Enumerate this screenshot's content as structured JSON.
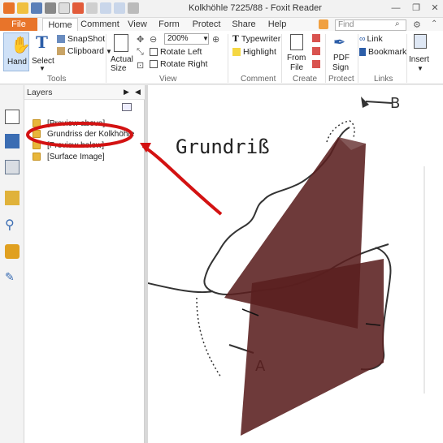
{
  "window": {
    "title": "Kolkhöhle 7225/88 - Foxit Reader",
    "minimize": "—",
    "restore": "❐",
    "close": "✕"
  },
  "tabs": {
    "file": "File",
    "items": [
      "Home",
      "Comment",
      "View",
      "Form",
      "Protect",
      "Share",
      "Help"
    ],
    "active": "Home"
  },
  "search": {
    "placeholder": "Find"
  },
  "ribbon": {
    "tools": {
      "hand": "Hand",
      "select": "Select",
      "snapshot": "SnapShot",
      "clipboard": "Clipboard",
      "group": "Tools"
    },
    "view": {
      "actual_size": "Actual Size",
      "zoom": "200%",
      "rotate_left": "Rotate Left",
      "rotate_right": "Rotate Right",
      "group": "View"
    },
    "comment": {
      "typewriter": "Typewriter",
      "highlight": "Highlight",
      "group": "Comment"
    },
    "create": {
      "from_file_l1": "From",
      "from_file_l2": "File",
      "group": "Create"
    },
    "protect": {
      "pdf_sign_l1": "PDF",
      "pdf_sign_l2": "Sign",
      "group": "Protect"
    },
    "links": {
      "link": "Link",
      "bookmark": "Bookmark",
      "group": "Links"
    },
    "insert": {
      "label": "Insert"
    }
  },
  "layers_panel": {
    "title": "Layers",
    "layers": [
      "[Preview above]",
      "Grundriss der Kolkhöhle",
      "[Preview below]",
      "[Surface Image]"
    ]
  },
  "document": {
    "heading": "Grundriß",
    "label_b": "B",
    "label_a": "A"
  },
  "colors": {
    "accent": "#e8742a",
    "annotation": "#d31212",
    "overlay": "#5a1f1f"
  }
}
